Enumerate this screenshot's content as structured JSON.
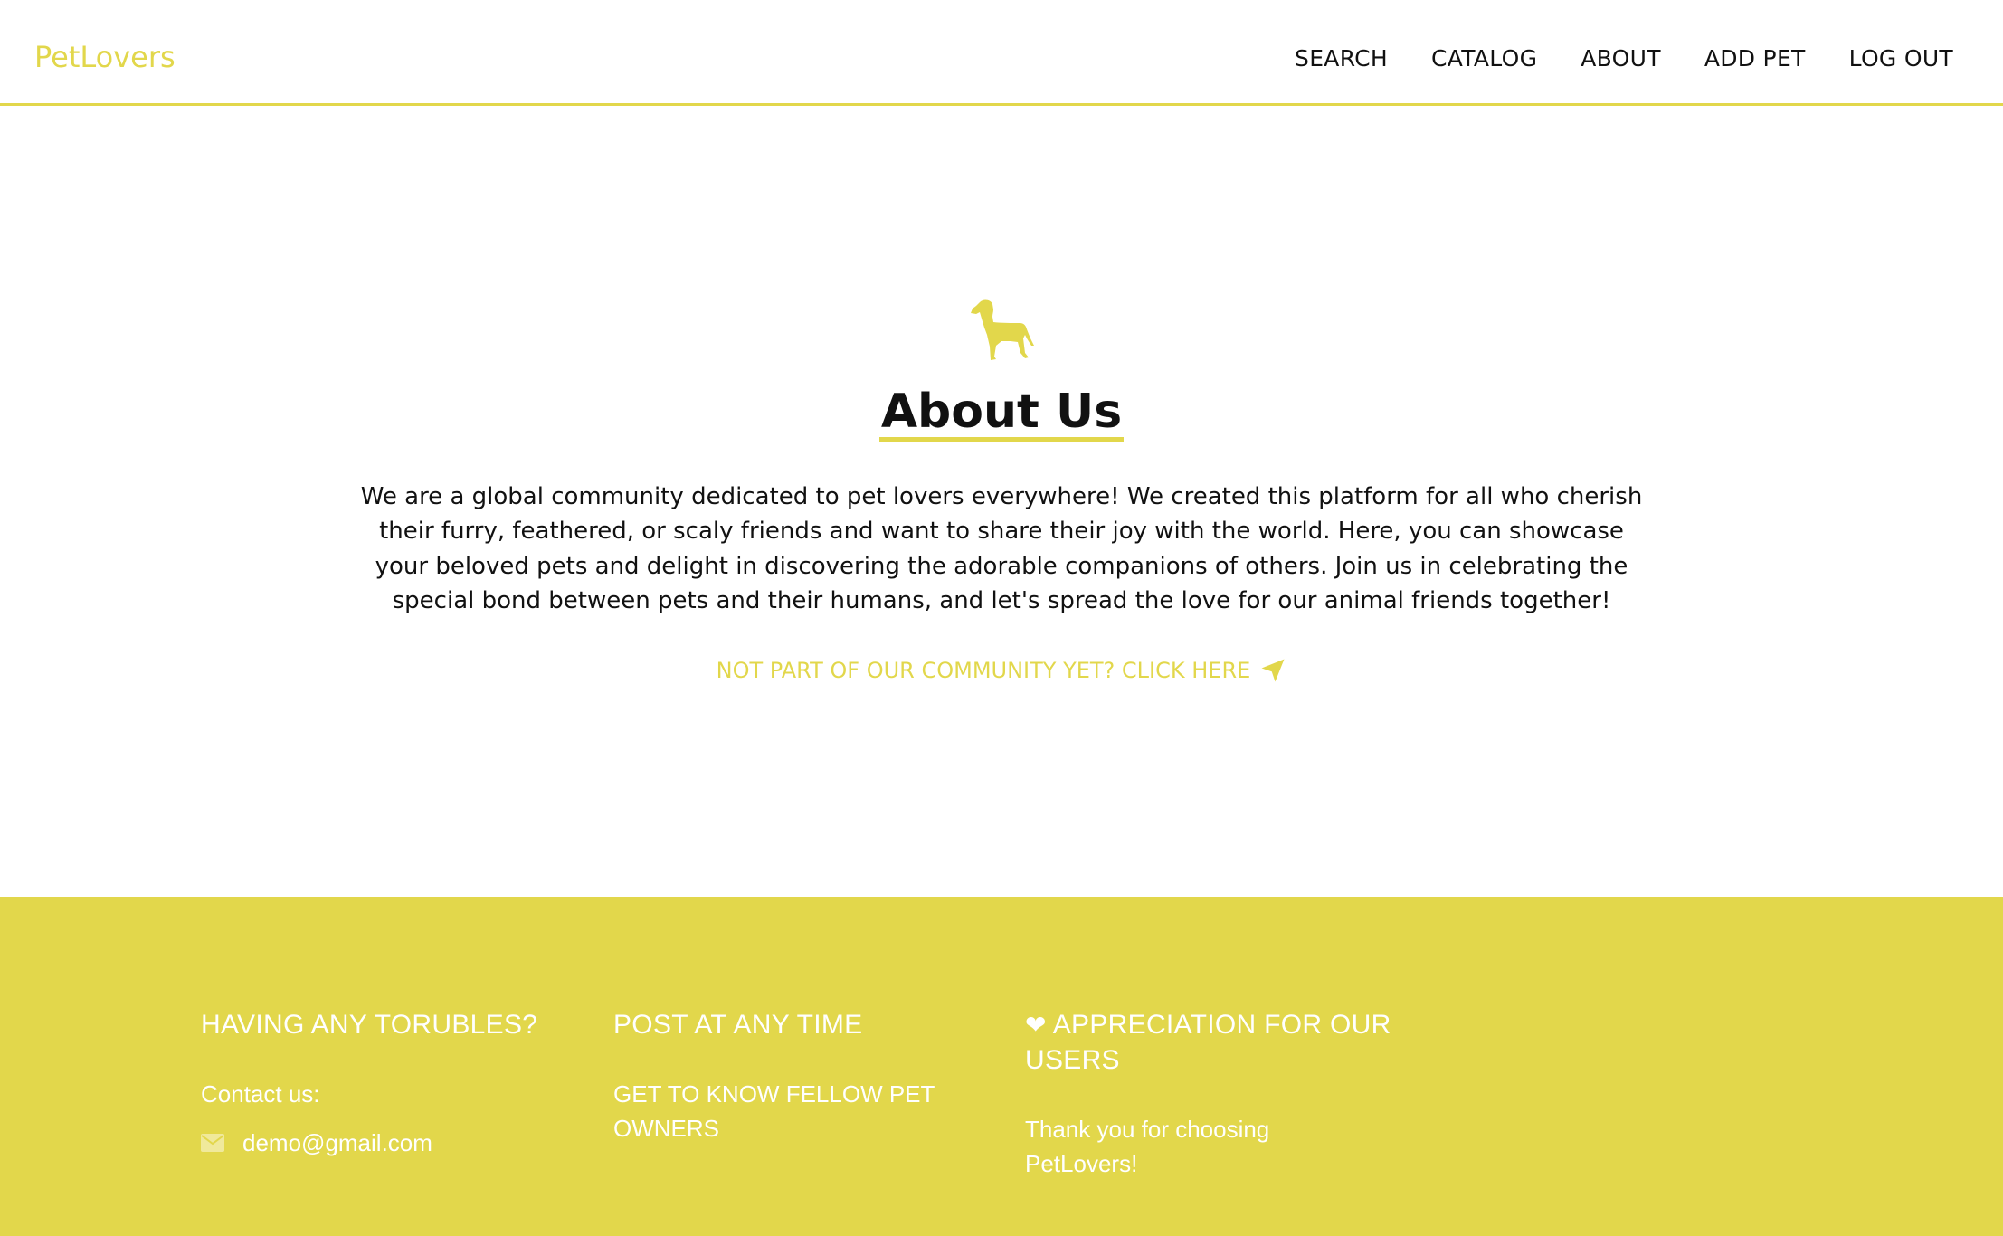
{
  "header": {
    "logo": "PetLovers",
    "nav": [
      "SEARCH",
      "CATALOG",
      "ABOUT",
      "ADD PET",
      "LOG OUT"
    ]
  },
  "about": {
    "title": "About Us",
    "description": "We are a global community dedicated to pet lovers everywhere! We created this platform for all who cherish their furry, feathered, or scaly friends and want to share their joy with the world. Here, you can showcase your beloved pets and delight in discovering the adorable companions of others. Join us in celebrating the special bond between pets and their humans, and let's spread the love for our animal friends together!",
    "cta": "NOT PART OF OUR COMMUNITY YET? CLICK HERE"
  },
  "footer": {
    "col1": {
      "heading": "HAVING ANY TORUBLES?",
      "contact": "Contact us:",
      "email": "demo@gmail.com"
    },
    "col2": {
      "heading": "POST AT ANY TIME",
      "text": "GET TO KNOW FELLOW PET OWNERS"
    },
    "col3": {
      "heart": "❤",
      "heading": "APPRECIATION FOR OUR USERS",
      "text": "Thank you for choosing PetLovers!"
    }
  },
  "colors": {
    "accent": "#e2d74b",
    "text": "#111111",
    "footer_text": "#ffffff"
  },
  "icons": [
    "dog-icon",
    "paper-plane-icon",
    "mail-icon",
    "heart-icon"
  ]
}
